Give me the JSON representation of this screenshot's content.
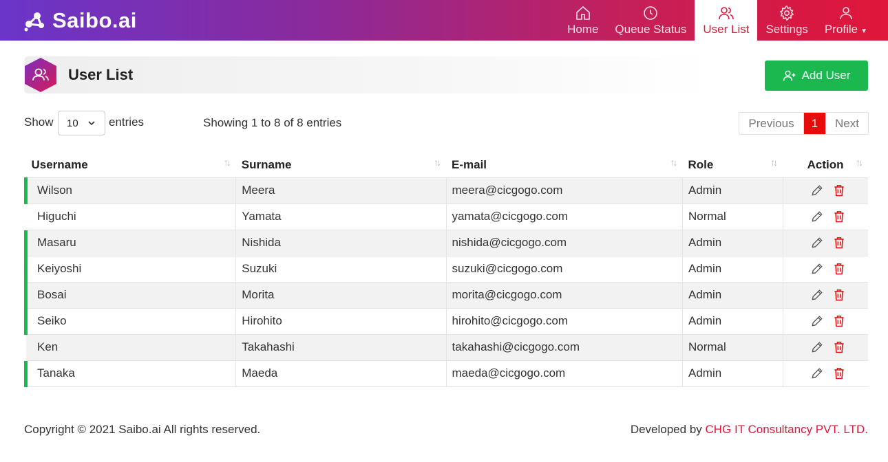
{
  "brand": {
    "name": "Saibo.ai"
  },
  "nav": {
    "items": [
      {
        "label": "Home",
        "icon": "home-icon",
        "active": false
      },
      {
        "label": "Queue Status",
        "icon": "clock-icon",
        "active": false
      },
      {
        "label": "User List",
        "icon": "users-icon",
        "active": true
      },
      {
        "label": "Settings",
        "icon": "gear-icon",
        "active": false
      },
      {
        "label": "Profile",
        "icon": "user-icon",
        "active": false
      }
    ]
  },
  "page": {
    "title": "User List",
    "add_button": "Add User"
  },
  "controls": {
    "show_label": "Show",
    "entries_value": "10",
    "entries_label": "entries",
    "info": "Showing 1 to 8 of 8 entries",
    "prev": "Previous",
    "current_page": "1",
    "next": "Next"
  },
  "table": {
    "columns": [
      "Username",
      "Surname",
      "E-mail",
      "Role",
      "Action"
    ],
    "rows": [
      {
        "username": "Wilson",
        "surname": "Meera",
        "email": "meera@cicgogo.com",
        "role": "Admin"
      },
      {
        "username": "Higuchi",
        "surname": "Yamata",
        "email": "yamata@cicgogo.com",
        "role": "Normal"
      },
      {
        "username": "Masaru",
        "surname": "Nishida",
        "email": "nishida@cicgogo.com",
        "role": "Admin"
      },
      {
        "username": "Keiyoshi",
        "surname": "Suzuki",
        "email": "suzuki@cicgogo.com",
        "role": "Admin"
      },
      {
        "username": "Bosai",
        "surname": "Morita",
        "email": "morita@cicgogo.com",
        "role": "Admin"
      },
      {
        "username": "Seiko",
        "surname": "Hirohito",
        "email": "hirohito@cicgogo.com",
        "role": "Admin"
      },
      {
        "username": "Ken",
        "surname": "Takahashi",
        "email": "takahashi@cicgogo.com",
        "role": "Normal"
      },
      {
        "username": "Tanaka",
        "surname": "Maeda",
        "email": "maeda@cicgogo.com",
        "role": "Admin"
      }
    ]
  },
  "footer": {
    "copyright": "Copyright © 2021 Saibo.ai All rights reserved.",
    "developed_by": "Developed by ",
    "company": "CHG IT Consultancy PVT. LTD."
  },
  "colors": {
    "accent": "#e0163a",
    "success": "#1ab84f",
    "gradient_start": "#6a35c9",
    "gradient_end": "#e0163a"
  }
}
